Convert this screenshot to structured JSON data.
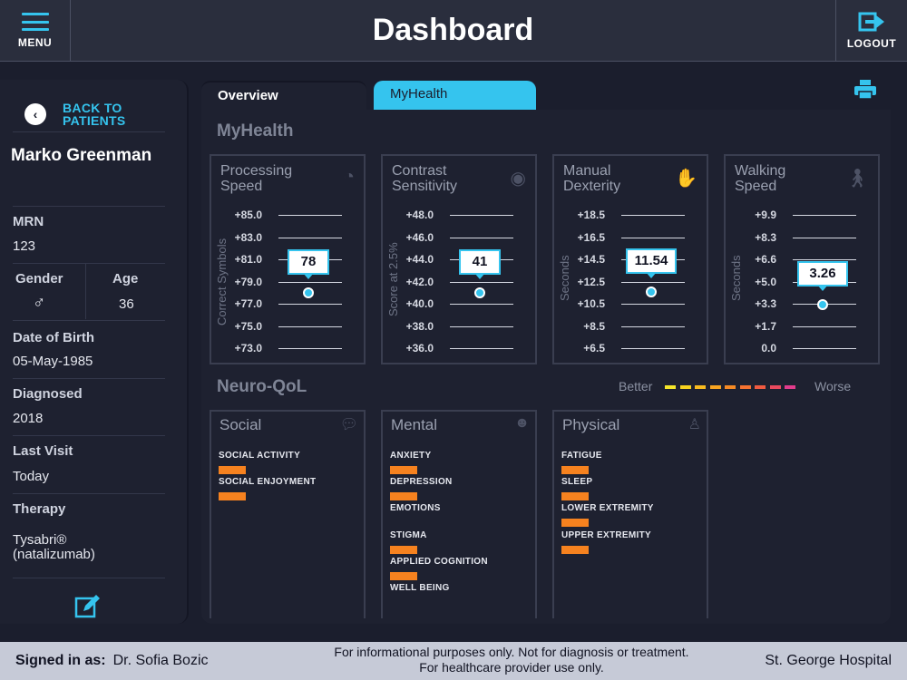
{
  "header": {
    "title": "Dashboard",
    "menu_label": "MENU",
    "logout_label": "LOGOUT"
  },
  "sidebar": {
    "back_label": "BACK TO\nPATIENTS",
    "patient_name": "Marko Greenman",
    "mrn_label": "MRN",
    "mrn": "123",
    "gender_label": "Gender",
    "gender_symbol": "♂",
    "age_label": "Age",
    "age": "36",
    "dob_label": "Date of Birth",
    "dob": "05-May-1985",
    "diagnosed_label": "Diagnosed",
    "diagnosed": "2018",
    "last_visit_label": "Last Visit",
    "last_visit": "Today",
    "therapy_label": "Therapy",
    "therapy": "Tysabri®\n(natalizumab)"
  },
  "tabs": [
    {
      "label": "Overview",
      "active": true
    },
    {
      "label": "MyHealth",
      "active": false
    }
  ],
  "myhealth": {
    "title": "MyHealth",
    "cards": [
      {
        "title": "Processing\nSpeed",
        "icon": "stopwatch-icon",
        "axis_label": "Correct Symbols",
        "ticks": [
          "+85.0",
          "+83.0",
          "+81.0",
          "+79.0",
          "+77.0",
          "+75.0",
          "+73.0"
        ],
        "value": "78",
        "value_num": 78,
        "min": 73,
        "max": 85
      },
      {
        "title": "Contrast\nSensitivity",
        "icon": "eye-icon",
        "axis_label": "Score at 2.5%",
        "ticks": [
          "+48.0",
          "+46.0",
          "+44.0",
          "+42.0",
          "+40.0",
          "+38.0",
          "+36.0"
        ],
        "value": "41",
        "value_num": 41,
        "min": 36,
        "max": 48
      },
      {
        "title": "Manual\nDexterity",
        "icon": "hands-icon",
        "axis_label": "Seconds",
        "ticks": [
          "+18.5",
          "+16.5",
          "+14.5",
          "+12.5",
          "+10.5",
          "+8.5",
          "+6.5"
        ],
        "value": "11.54",
        "value_num": 11.54,
        "min": 6.5,
        "max": 18.5
      },
      {
        "title": "Walking\nSpeed",
        "icon": "walking-icon",
        "axis_label": "Seconds",
        "ticks": [
          "+9.9",
          "+8.3",
          "+6.6",
          "+5.0",
          "+3.3",
          "+1.7",
          "0.0"
        ],
        "value": "3.26",
        "value_num": 3.26,
        "min": 0,
        "max": 9.9
      }
    ]
  },
  "neuroqol": {
    "title": "Neuro-QoL",
    "legend": {
      "better": "Better",
      "worse": "Worse",
      "colors": [
        "#f5e62a",
        "#f7d21f",
        "#f9bb1f",
        "#f8a421",
        "#f68a24",
        "#f57230",
        "#f05a40",
        "#ea4a5e",
        "#e23c8c"
      ]
    },
    "cards": [
      {
        "title": "Social",
        "icon": "chat-icon",
        "items": [
          "SOCIAL ACTIVITY",
          "SOCIAL ENJOYMENT"
        ]
      },
      {
        "title": "Mental",
        "icon": "smiley-icon",
        "items": [
          "ANXIETY",
          "DEPRESSION",
          "EMOTIONS",
          "STIGMA",
          "APPLIED COGNITION",
          "WELL BEING"
        ]
      },
      {
        "title": "Physical",
        "icon": "person-icon",
        "items": [
          "FATIGUE",
          "SLEEP",
          "LOWER EXTREMITY",
          "UPPER EXTREMITY"
        ]
      }
    ],
    "bar_color": "#f6821f"
  },
  "footer": {
    "signed_label": "Signed in as:",
    "doctor": "Dr. Sofia Bozic",
    "disclaimer_1": "For informational purposes only. Not for diagnosis or treatment.",
    "disclaimer_2": "For healthcare provider use only.",
    "hospital": "St. George Hospital"
  }
}
